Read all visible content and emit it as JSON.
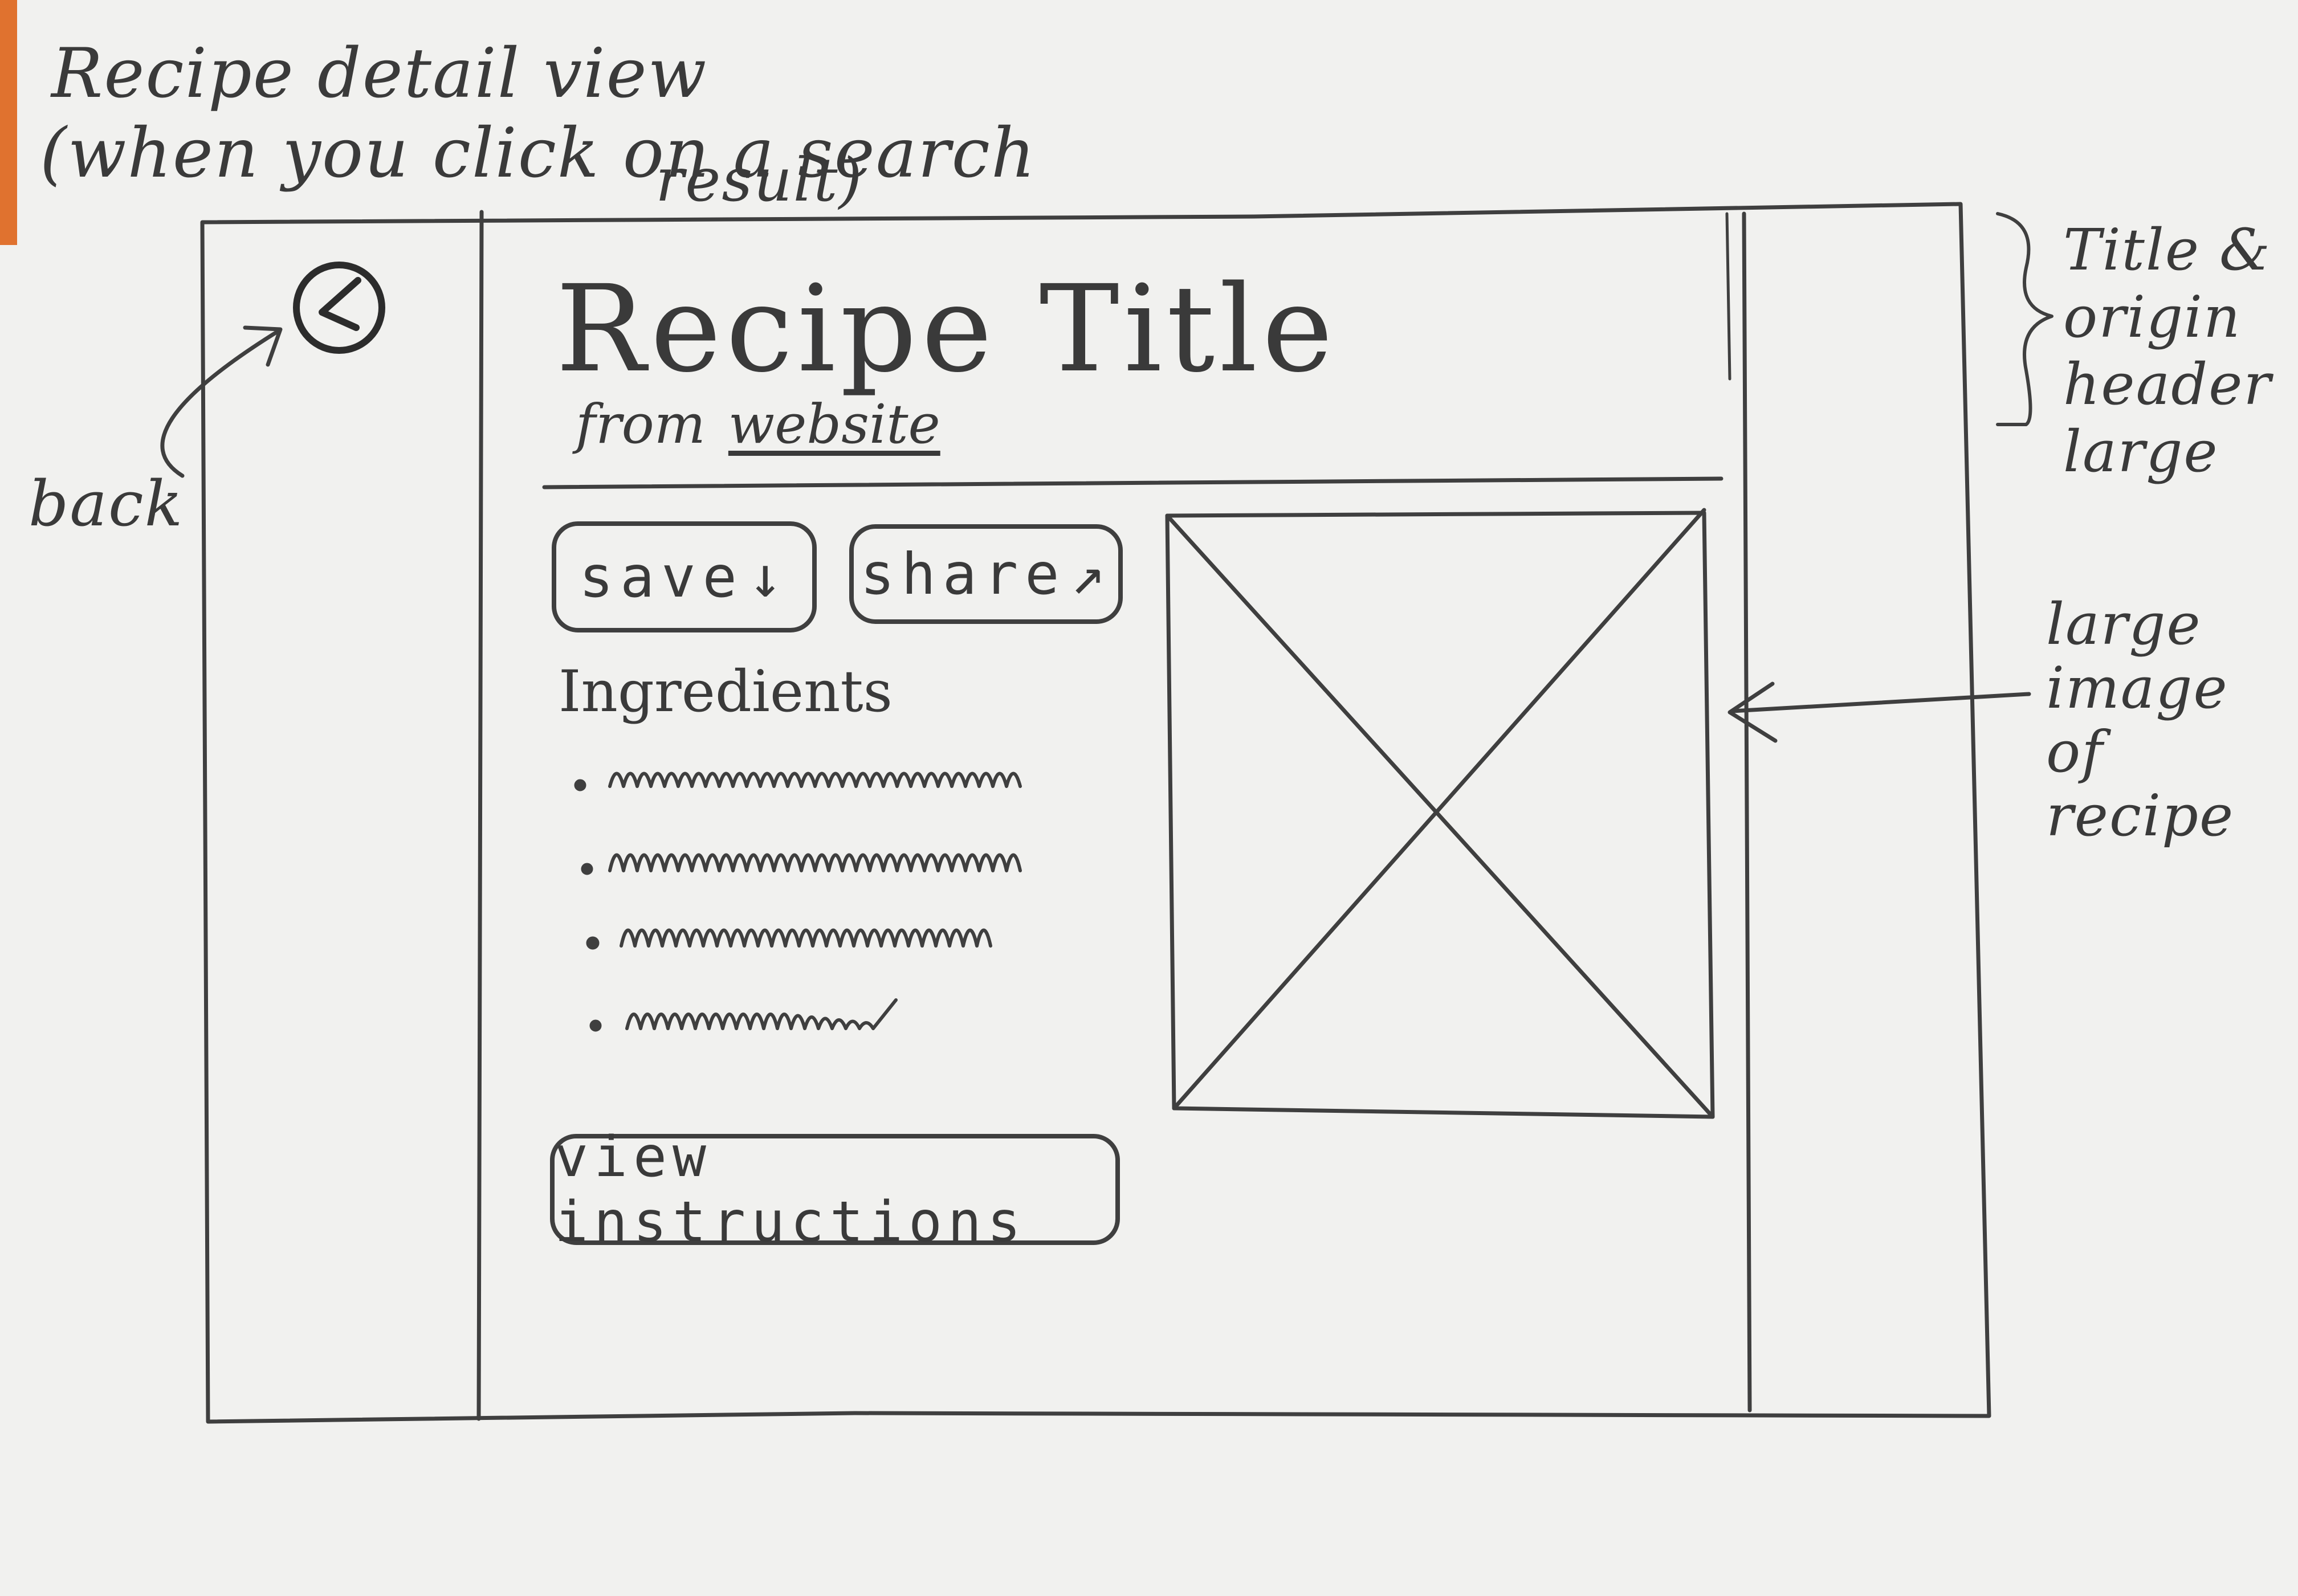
{
  "annotations": {
    "title": "Recipe detail view",
    "subtitle": "(when you click on a search",
    "subtitle_cont": "result)",
    "back": "back",
    "header_note": "Title & origin header large",
    "image_note": "large image of recipe"
  },
  "header": {
    "title": "Recipe Title",
    "from_label": "from",
    "source_link": "website"
  },
  "actions": {
    "save_label": "save",
    "share_label": "share",
    "view_instructions_label": "view instructions"
  },
  "ingredients": {
    "heading": "Ingredients",
    "item_count": 4
  },
  "icons": {
    "back": "back-arrow-icon",
    "save": "down-arrow-icon",
    "share": "up-right-arrow-icon",
    "image_placeholder": "image-placeholder-icon"
  },
  "colors": {
    "paper": "#f1f1ef",
    "pencil": "#3f3f3f",
    "edge": "#e0722f"
  }
}
